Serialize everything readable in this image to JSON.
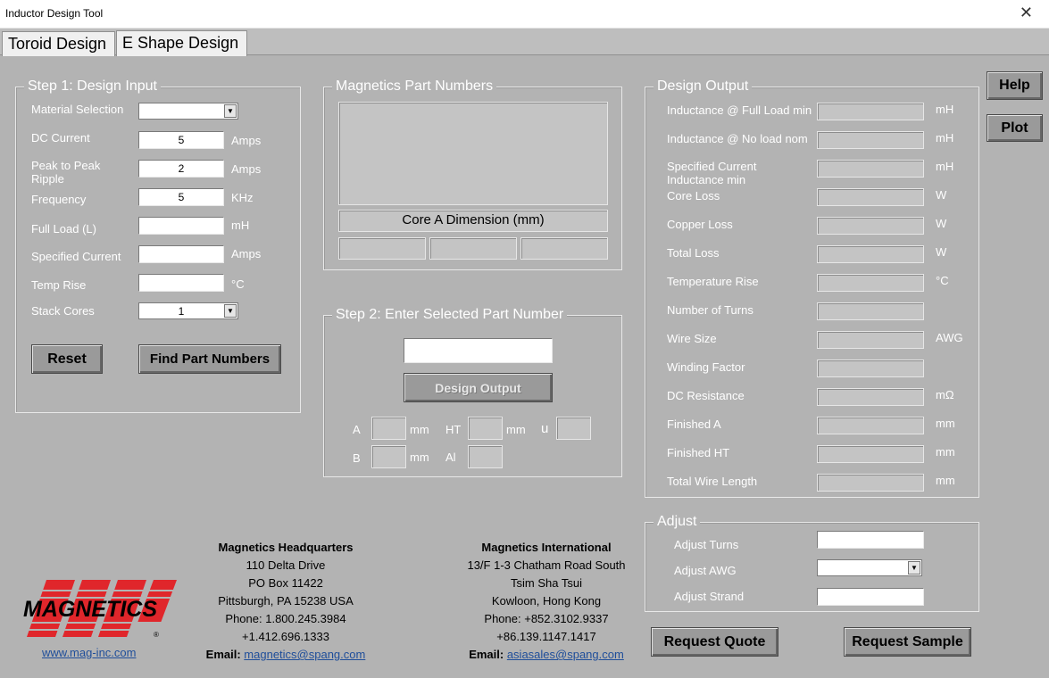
{
  "window": {
    "title": "Inductor Design Tool",
    "close": "✕"
  },
  "tabs": [
    "Toroid Design",
    "E Shape Design"
  ],
  "step1": {
    "legend": "Step 1: Design Input",
    "material_label": "Material Selection",
    "material_value": "",
    "dc_current_label": "DC Current",
    "dc_current_value": "5",
    "dc_current_unit": "Amps",
    "ripple_label": "Peak to Peak\nRipple",
    "ripple_value": "2",
    "ripple_unit": "Amps",
    "freq_label": "Frequency",
    "freq_value": "5",
    "freq_unit": "KHz",
    "full_load_label": "Full Load (L)",
    "full_load_value": "",
    "full_load_unit": "mH",
    "spec_current_label": "Specified Current",
    "spec_current_value": "",
    "spec_current_unit": "Amps",
    "temp_rise_label": "Temp Rise",
    "temp_rise_value": "",
    "temp_rise_unit": "°C",
    "stack_label": "Stack Cores",
    "stack_value": "1",
    "reset_button": "Reset",
    "find_button": "Find Part Numbers"
  },
  "parts": {
    "legend": "Magnetics Part Numbers",
    "core_dim": "Core A Dimension (mm)"
  },
  "step2": {
    "legend": "Step 2: Enter Selected Part Number",
    "part_value": "",
    "design_button": "Design Output",
    "a_label": "A",
    "ht_label": "HT",
    "u_label": "u",
    "b_label": "B",
    "al_label": "Al",
    "mm": "mm"
  },
  "output": {
    "legend": "Design Output",
    "rows": [
      {
        "label": "Inductance @ Full Load min",
        "unit": "mH"
      },
      {
        "label": "Inductance @ No load nom",
        "unit": "mH"
      },
      {
        "label": "Specified Current\nInductance min",
        "unit": "mH"
      },
      {
        "label": "Core Loss",
        "unit": "W"
      },
      {
        "label": "Copper Loss",
        "unit": "W"
      },
      {
        "label": "Total Loss",
        "unit": "W"
      },
      {
        "label": "Temperature Rise",
        "unit": "°C"
      },
      {
        "label": "Number of Turns",
        "unit": ""
      },
      {
        "label": "Wire Size",
        "unit": "AWG"
      },
      {
        "label": "Winding Factor",
        "unit": ""
      },
      {
        "label": "DC Resistance",
        "unit": "mΩ"
      },
      {
        "label": "Finished A",
        "unit": "mm"
      },
      {
        "label": "Finished HT",
        "unit": "mm"
      },
      {
        "label": "Total Wire Length",
        "unit": "mm"
      }
    ]
  },
  "adjust": {
    "legend": "Adjust",
    "turns_label": "Adjust Turns",
    "awg_label": "Adjust AWG",
    "strand_label": "Adjust Strand"
  },
  "side": {
    "help_button": "Help",
    "plot_button": "Plot"
  },
  "quote_button": "Request Quote",
  "sample_button": "Request Sample",
  "hq": {
    "title": "Magnetics Headquarters",
    "lines": [
      "110 Delta Drive",
      "PO Box 11422",
      "Pittsburgh, PA 15238 USA",
      "Phone: 1.800.245.3984",
      "+1.412.696.1333"
    ],
    "email_label": "Email:",
    "email": "magnetics@spang.com"
  },
  "intl": {
    "title": "Magnetics International",
    "lines": [
      "13/F 1-3 Chatham Road South",
      "Tsim Sha Tsui",
      "Kowloon, Hong Kong",
      "Phone: +852.3102.9337",
      "+86.139.1147.1417"
    ],
    "email_label": "Email:",
    "email": "asiasales@spang.com"
  },
  "logo": {
    "text": "MAGNETICS",
    "reg": "®",
    "url": "www.mag-inc.com",
    "color": "#e0262b"
  }
}
